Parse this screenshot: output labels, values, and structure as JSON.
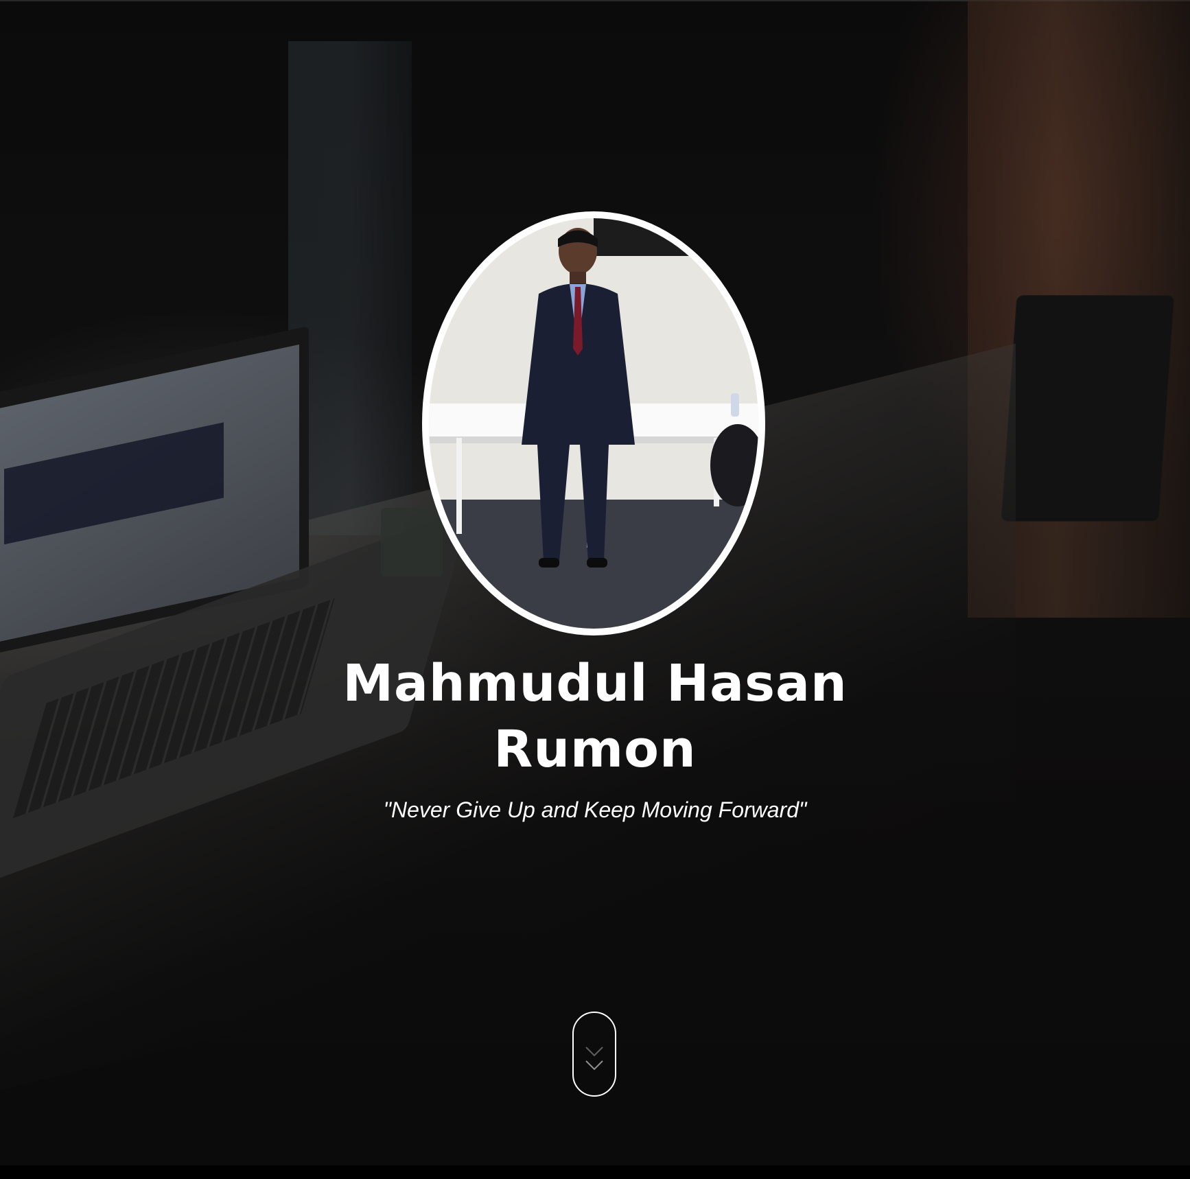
{
  "profile": {
    "name": "Mahmudul Hasan Rumon",
    "tagline": "\"Never Give Up and Keep Moving Forward\""
  },
  "icons": {
    "scroll": "chevron-down-icon"
  },
  "colors": {
    "text": "#ffffff",
    "background": "#0d0c0c",
    "avatar_border": "#ffffff"
  }
}
